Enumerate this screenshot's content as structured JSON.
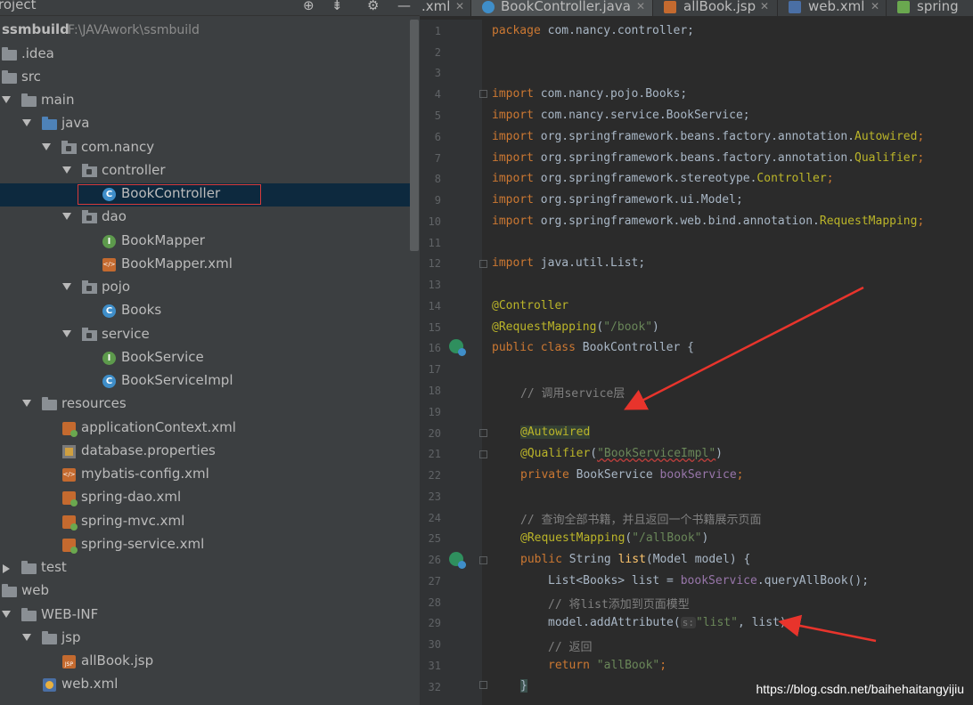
{
  "project_panel": {
    "title": "roject",
    "tree": [
      {
        "label": "ssmbuild",
        "sub": "F:\\JAVAwork\\ssmbuild",
        "bold": true
      },
      {
        "label": ".idea"
      },
      {
        "label": "src"
      },
      {
        "label": "main"
      },
      {
        "label": "java"
      },
      {
        "label": "com.nancy"
      },
      {
        "label": "controller"
      },
      {
        "label": "BookController"
      },
      {
        "label": "dao"
      },
      {
        "label": "BookMapper"
      },
      {
        "label": "BookMapper.xml"
      },
      {
        "label": "pojo"
      },
      {
        "label": "Books"
      },
      {
        "label": "service"
      },
      {
        "label": "BookService"
      },
      {
        "label": "BookServiceImpl"
      },
      {
        "label": "resources"
      },
      {
        "label": "applicationContext.xml"
      },
      {
        "label": "database.properties"
      },
      {
        "label": "mybatis-config.xml"
      },
      {
        "label": "spring-dao.xml"
      },
      {
        "label": "spring-mvc.xml"
      },
      {
        "label": "spring-service.xml"
      },
      {
        "label": "test"
      },
      {
        "label": "web"
      },
      {
        "label": "WEB-INF"
      },
      {
        "label": "jsp"
      },
      {
        "label": "allBook.jsp"
      },
      {
        "label": "web.xml"
      }
    ]
  },
  "tabs": [
    {
      "label": ".xml"
    },
    {
      "label": "BookController.java",
      "active": true
    },
    {
      "label": "allBook.jsp"
    },
    {
      "label": "web.xml"
    },
    {
      "label": "spring"
    }
  ],
  "line_numbers": [
    "1",
    "2",
    "3",
    "4",
    "5",
    "6",
    "7",
    "8",
    "9",
    "10",
    "11",
    "12",
    "13",
    "14",
    "15",
    "16",
    "17",
    "18",
    "19",
    "20",
    "21",
    "22",
    "23",
    "24",
    "25",
    "26",
    "27",
    "28",
    "29",
    "30",
    "31",
    "32"
  ],
  "code": {
    "l1": {
      "kw": "package",
      "rest": " com.nancy.controller;"
    },
    "l4": {
      "kw": "import",
      "rest": " com.nancy.pojo.Books;"
    },
    "l5": {
      "kw": "import",
      "rest": " com.nancy.service.BookService;"
    },
    "l6": {
      "kw": "import",
      "rest": " org.springframework.beans.factory.annotation.",
      "an": "Autowired",
      "end": ";"
    },
    "l7": {
      "kw": "import",
      "rest": " org.springframework.beans.factory.annotation.",
      "an": "Qualifier",
      "end": ";"
    },
    "l8": {
      "kw": "import",
      "rest": " org.springframework.stereotype.",
      "an": "Controller",
      "end": ";"
    },
    "l9": {
      "kw": "import",
      "rest": " org.springframework.ui.Model;"
    },
    "l10": {
      "kw": "import",
      "rest": " org.springframework.web.bind.annotation.",
      "an": "RequestMapping",
      "end": ";"
    },
    "l12": {
      "kw": "import",
      "rest": " java.util.List;"
    },
    "l14": {
      "an": "@Controller"
    },
    "l15": {
      "an": "@RequestMapping",
      "p1": "(",
      "st": "\"/book\"",
      "p2": ")"
    },
    "l16": {
      "kw": "public class",
      "rest": " BookController {"
    },
    "l18": {
      "cm": "// 调用service层"
    },
    "l20": {
      "an": "@Autowired"
    },
    "l21": {
      "an": "@Qualifier",
      "p1": "(",
      "st": "\"BookServiceImpl\"",
      "p2": ")"
    },
    "l22": {
      "kw": "private",
      "rest": " BookService ",
      "fd": "bookService",
      "end": ";"
    },
    "l24": {
      "cm": "// 查询全部书籍，并且返回一个书籍展示页面"
    },
    "l25": {
      "an": "@RequestMapping",
      "p1": "(",
      "st": "\"/allBook\"",
      "p2": ")"
    },
    "l26": {
      "kw": "public",
      "rest": " String ",
      "fn": "list",
      "rest2": "(Model model) {"
    },
    "l27": {
      "rest": "List<Books> list = ",
      "fd": "bookService",
      "rest2": ".queryAllBook();"
    },
    "l28": {
      "cm": "// 将list添加到页面模型"
    },
    "l29": {
      "rest": "model.addAttribute(",
      "hint": "s:",
      "st": "\"list\"",
      "rest2": ", list);"
    },
    "l30": {
      "cm": "// 返回"
    },
    "l31": {
      "kw": "return",
      "st": " \"allBook\"",
      "end": ";"
    },
    "l32": {
      "rest": "}"
    }
  },
  "watermark": "https://blog.csdn.net/baihehaitangyijiu",
  "colors": {
    "keyword": "#cc7832",
    "annotation": "#bbb529",
    "string": "#6a8759",
    "comment": "#808080",
    "field": "#9876aa",
    "arrow": "#e8342c"
  }
}
